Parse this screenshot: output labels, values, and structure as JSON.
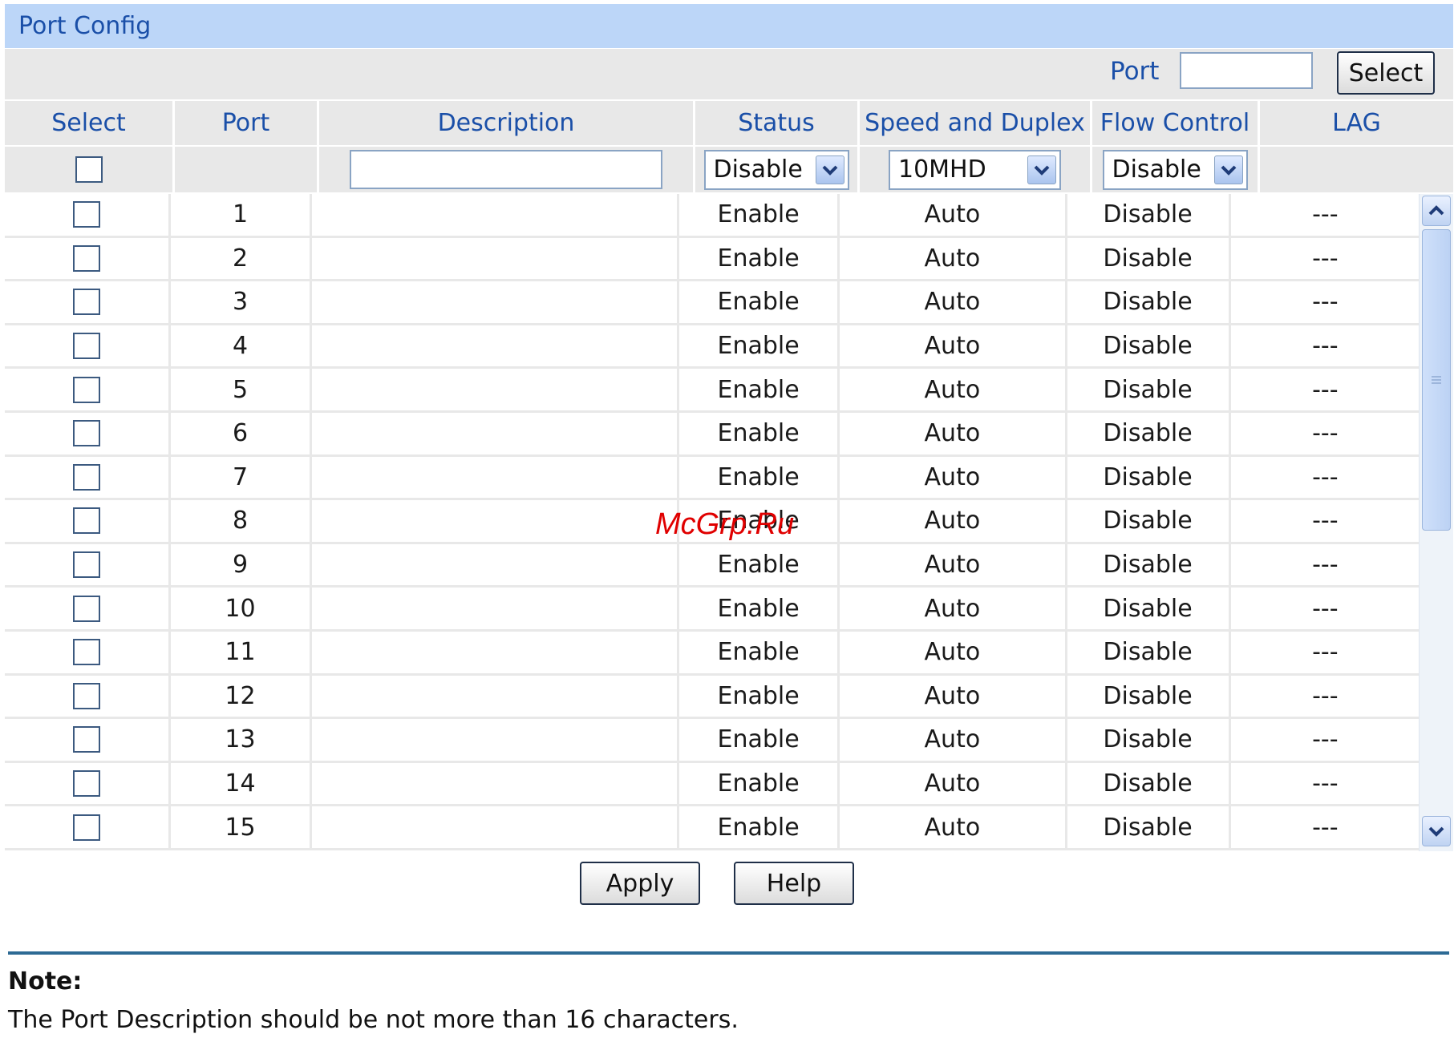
{
  "panel": {
    "title": "Port Config"
  },
  "port_select": {
    "label": "Port",
    "input_value": "",
    "button_label": "Select"
  },
  "table": {
    "headers": [
      "Select",
      "Port",
      "Description",
      "Status",
      "Speed and Duplex",
      "Flow Control",
      "LAG"
    ],
    "filter": {
      "description_value": "",
      "status_selected": "Disable",
      "speed_selected": "10MHD",
      "flow_selected": "Disable"
    },
    "rows": [
      {
        "port": "1",
        "description": "",
        "status": "Enable",
        "speed": "Auto",
        "flow": "Disable",
        "lag": "---"
      },
      {
        "port": "2",
        "description": "",
        "status": "Enable",
        "speed": "Auto",
        "flow": "Disable",
        "lag": "---"
      },
      {
        "port": "3",
        "description": "",
        "status": "Enable",
        "speed": "Auto",
        "flow": "Disable",
        "lag": "---"
      },
      {
        "port": "4",
        "description": "",
        "status": "Enable",
        "speed": "Auto",
        "flow": "Disable",
        "lag": "---"
      },
      {
        "port": "5",
        "description": "",
        "status": "Enable",
        "speed": "Auto",
        "flow": "Disable",
        "lag": "---"
      },
      {
        "port": "6",
        "description": "",
        "status": "Enable",
        "speed": "Auto",
        "flow": "Disable",
        "lag": "---"
      },
      {
        "port": "7",
        "description": "",
        "status": "Enable",
        "speed": "Auto",
        "flow": "Disable",
        "lag": "---"
      },
      {
        "port": "8",
        "description": "",
        "status": "Enable",
        "speed": "Auto",
        "flow": "Disable",
        "lag": "---"
      },
      {
        "port": "9",
        "description": "",
        "status": "Enable",
        "speed": "Auto",
        "flow": "Disable",
        "lag": "---"
      },
      {
        "port": "10",
        "description": "",
        "status": "Enable",
        "speed": "Auto",
        "flow": "Disable",
        "lag": "---"
      },
      {
        "port": "11",
        "description": "",
        "status": "Enable",
        "speed": "Auto",
        "flow": "Disable",
        "lag": "---"
      },
      {
        "port": "12",
        "description": "",
        "status": "Enable",
        "speed": "Auto",
        "flow": "Disable",
        "lag": "---"
      },
      {
        "port": "13",
        "description": "",
        "status": "Enable",
        "speed": "Auto",
        "flow": "Disable",
        "lag": "---"
      },
      {
        "port": "14",
        "description": "",
        "status": "Enable",
        "speed": "Auto",
        "flow": "Disable",
        "lag": "---"
      },
      {
        "port": "15",
        "description": "",
        "status": "Enable",
        "speed": "Auto",
        "flow": "Disable",
        "lag": "---"
      }
    ]
  },
  "actions": {
    "apply_label": "Apply",
    "help_label": "Help"
  },
  "note": {
    "title": "Note:",
    "text": "The Port Description should be not more than 16 characters."
  },
  "watermark": "McGrp.Ru",
  "colors": {
    "title_bar": "#bcd6f8",
    "header_text": "#1a4fa8",
    "header_bg": "#e8e8e8",
    "rule": "#2d6a94",
    "watermark": "#e00000"
  }
}
